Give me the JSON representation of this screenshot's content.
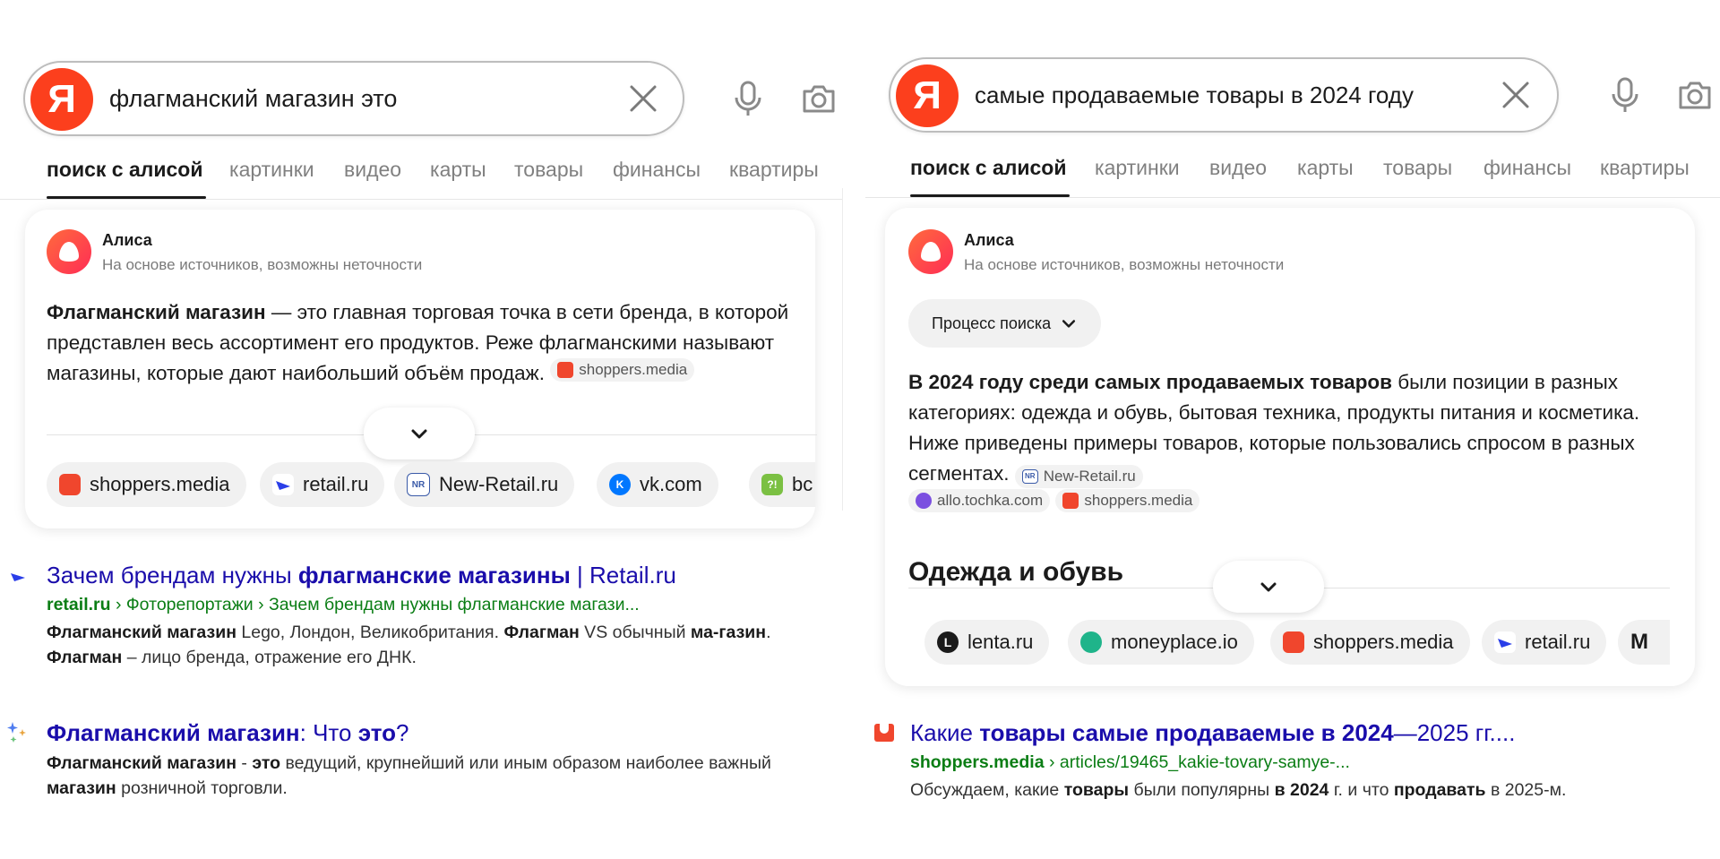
{
  "colors": {
    "yandex_red": "#fc3f1d",
    "link": "#1a0dab",
    "url_green": "#0a7d14"
  },
  "left": {
    "search": {
      "query": "флагманский магазин это",
      "logo": "Я"
    },
    "tabs": [
      {
        "label": "поиск с алисой"
      },
      {
        "label": "картинки"
      },
      {
        "label": "видео"
      },
      {
        "label": "карты"
      },
      {
        "label": "товары"
      },
      {
        "label": "финансы"
      },
      {
        "label": "квартиры"
      }
    ],
    "alice": {
      "name": "Алиса",
      "subtitle": "На основе источников, возможны неточности",
      "answer_bold": "Флагманский магазин",
      "answer_rest": " — это главная торговая точка в сети бренда, в которой представлен весь ассортимент его продуктов. Реже флагманскими называют магазины, которые дают наибольший объём продаж.",
      "inline_source": "shoppers.media",
      "chips": [
        {
          "label": "shoppers.media"
        },
        {
          "label": "retail.ru"
        },
        {
          "label": "New-Retail.ru"
        },
        {
          "label": "vk.com"
        },
        {
          "label": "bc"
        }
      ]
    },
    "results": [
      {
        "title_a": "Зачем брендам нужны ",
        "title_b": "флагманские магазины",
        "title_c": " | Retail.ru",
        "domain": "retail.ru",
        "path": " › Фоторепортажи › Зачем брендам нужны флагманские магази...",
        "snippet": [
          {
            "b": "Флагманский магазин"
          },
          {
            "t": " Lego, Лондон, Великобритания. "
          },
          {
            "b": "Флагман"
          },
          {
            "t": " VS обычный "
          },
          {
            "b": "ма-газин"
          },
          {
            "t": ". "
          },
          {
            "b": "Флагман"
          },
          {
            "t": " – лицо бренда, отражение его ДНК."
          }
        ]
      },
      {
        "title_a": "Флагманский магазин",
        "title_b": ": Что ",
        "title_c": "это",
        "title_d": "?",
        "snippet": [
          {
            "b": "Флагманский магазин"
          },
          {
            "t": " - "
          },
          {
            "b": "это"
          },
          {
            "t": " ведущий, крупнейший или иным образом наиболее важный "
          },
          {
            "b": "магазин"
          },
          {
            "t": " розничной торговли."
          }
        ]
      }
    ]
  },
  "right": {
    "search": {
      "query": "самые продаваемые товары в 2024 году",
      "logo": "Я"
    },
    "tabs": [
      {
        "label": "поиск с алисой"
      },
      {
        "label": "картинки"
      },
      {
        "label": "видео"
      },
      {
        "label": "карты"
      },
      {
        "label": "товары"
      },
      {
        "label": "финансы"
      },
      {
        "label": "квартиры"
      }
    ],
    "alice": {
      "name": "Алиса",
      "subtitle": "На основе источников, возможны неточности",
      "process_label": "Процесс поиска",
      "answer_bold": "В 2024 году среди самых продаваемых товаров",
      "answer_rest": " были позиции в разных категориях: одежда и обувь, бытовая техника, продукты питания и косметика. Ниже приведены примеры товаров, которые пользовались спросом в разных сегментах.",
      "inline_sources": [
        "New-Retail.ru",
        "allo.tochka.com",
        "shoppers.media"
      ],
      "section_heading": "Одежда и обувь",
      "chips": [
        {
          "label": "lenta.ru"
        },
        {
          "label": "moneyplace.io"
        },
        {
          "label": "shoppers.media"
        },
        {
          "label": "retail.ru"
        },
        {
          "label": "M"
        }
      ]
    },
    "result": {
      "title_a": "Какие ",
      "title_b": "товары самые продаваемые в 2024",
      "title_c": "—2025 гг....",
      "domain": "shoppers.media",
      "path": " › articles/19465_kakie-tovary-samye-...",
      "snippet": [
        {
          "t": "Обсуждаем, какие "
        },
        {
          "b": "товары"
        },
        {
          "t": " были популярны "
        },
        {
          "b": "в 2024"
        },
        {
          "t": " г. и что "
        },
        {
          "b": "продавать"
        },
        {
          "t": " в 2025-м."
        }
      ]
    }
  }
}
